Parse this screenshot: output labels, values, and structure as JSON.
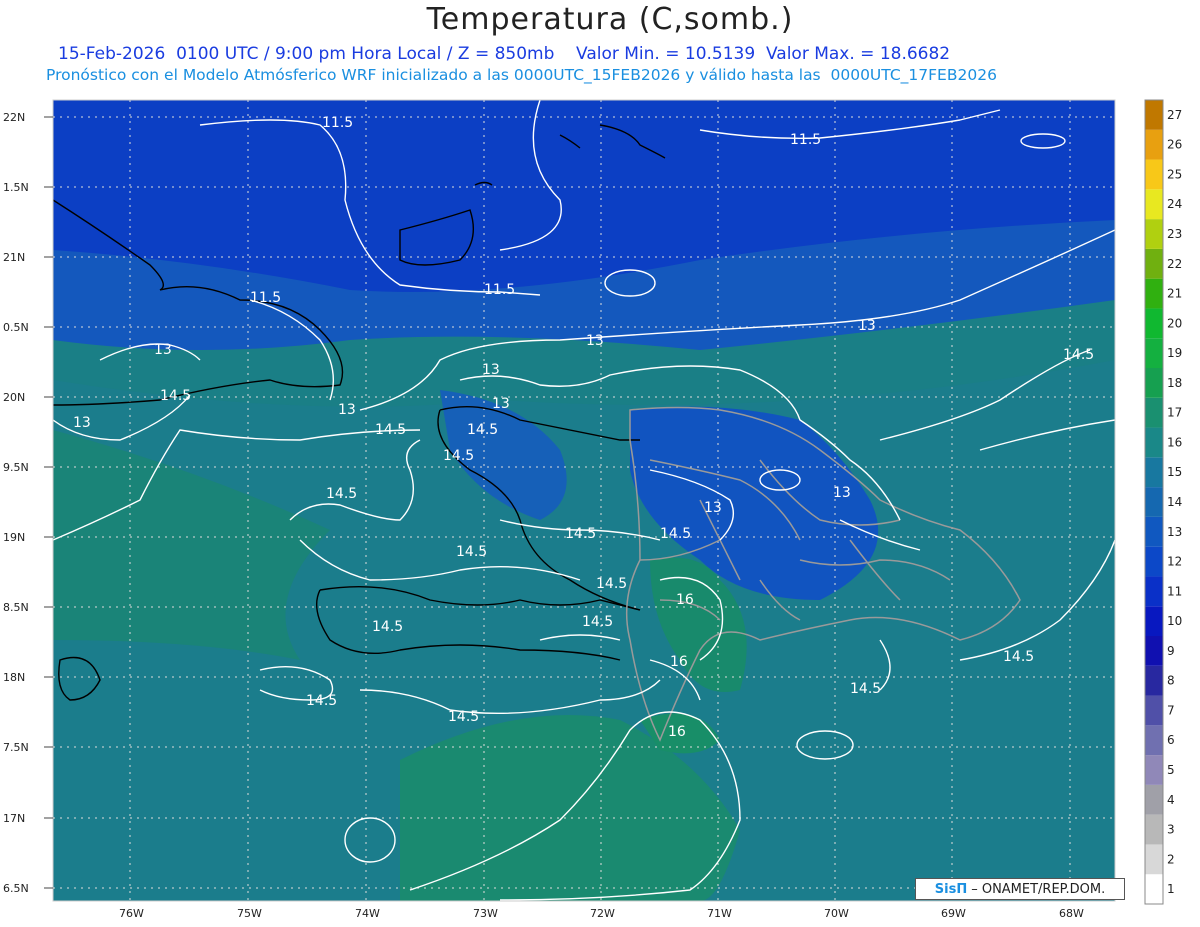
{
  "header": {
    "title": "Temperatura (C,somb.)",
    "line1": "15-Feb-2026  0100 UTC / 9:00 pm Hora Local / Z = 850mb    Valor Min. = 10.5139  Valor Max. = 18.6682",
    "line2": "Pronóstico con el Modelo Atmósferico WRF inicializado a las 0000UTC_15FEB2026 y válido hasta las  0000UTC_17FEB2026"
  },
  "axes": {
    "lat_labels": [
      "22N",
      "1.5N",
      "21N",
      "0.5N",
      "20N",
      "9.5N",
      "19N",
      "8.5N",
      "18N",
      "7.5N",
      "17N",
      "6.5N"
    ],
    "lon_labels": [
      "76W",
      "75W",
      "74W",
      "73W",
      "72W",
      "71W",
      "70W",
      "69W",
      "68W"
    ]
  },
  "colorbar": {
    "labels": [
      "1",
      "2",
      "3",
      "4",
      "5",
      "6",
      "7",
      "8",
      "9",
      "10",
      "11",
      "12",
      "13",
      "14",
      "15",
      "16",
      "17",
      "18",
      "19",
      "20",
      "21",
      "22",
      "23",
      "24",
      "25",
      "26",
      "27"
    ],
    "colors": [
      "#ffffff",
      "#d8d8d8",
      "#b8b8b8",
      "#a0a0a8",
      "#9088b8",
      "#7070b0",
      "#5050a8",
      "#2828a0",
      "#1010b0",
      "#0818c0",
      "#0a30c8",
      "#0c48c8",
      "#1058c0",
      "#1568b0",
      "#1878a0",
      "#1a8888",
      "#1a9070",
      "#16a050",
      "#14b040",
      "#10b830",
      "#30b010",
      "#70b010",
      "#b0d010",
      "#e8e820",
      "#f8c818",
      "#e8a010",
      "#c07800"
    ]
  },
  "contour_labels": [
    {
      "text": "11.5"
    },
    {
      "text": "11.5"
    },
    {
      "text": "11.5"
    },
    {
      "text": "11.5"
    },
    {
      "text": "13"
    },
    {
      "text": "13"
    },
    {
      "text": "13"
    },
    {
      "text": "13"
    },
    {
      "text": "13"
    },
    {
      "text": "13"
    },
    {
      "text": "13"
    },
    {
      "text": "13"
    },
    {
      "text": "13"
    },
    {
      "text": "14.5"
    },
    {
      "text": "14.5"
    },
    {
      "text": "14.5"
    },
    {
      "text": "14.5"
    },
    {
      "text": "14.5"
    },
    {
      "text": "14.5"
    },
    {
      "text": "14.5"
    },
    {
      "text": "14.5"
    },
    {
      "text": "14.5"
    },
    {
      "text": "14.5"
    },
    {
      "text": "14.5"
    },
    {
      "text": "14.5"
    },
    {
      "text": "14.5"
    },
    {
      "text": "14.5"
    },
    {
      "text": "16"
    },
    {
      "text": "16"
    },
    {
      "text": "16"
    }
  ],
  "credit": {
    "logo": "SisΠ",
    "text": "– ONAMET/REP.DOM."
  }
}
